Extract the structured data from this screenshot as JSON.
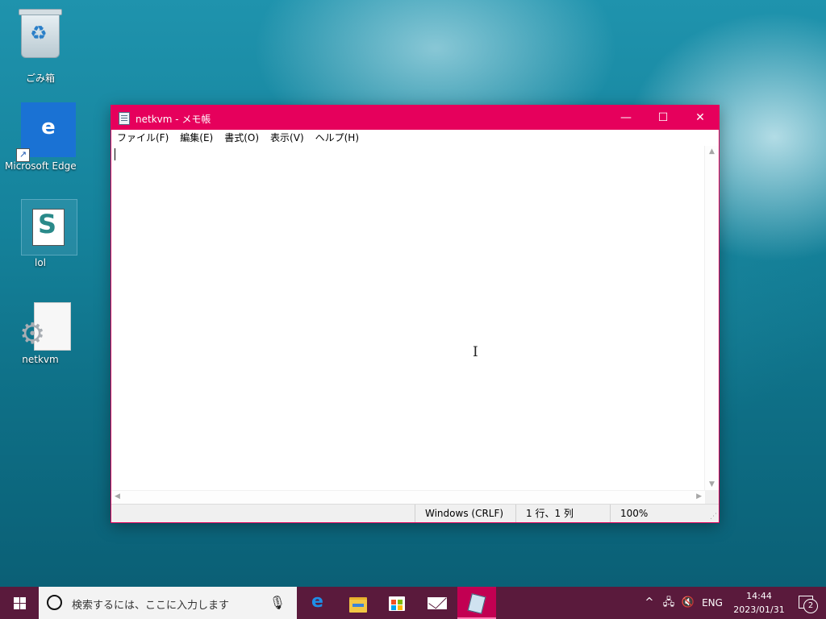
{
  "desktop": {
    "icons": [
      {
        "label": "ごみ箱",
        "icon": "recycle-bin-icon"
      },
      {
        "label": "Microsoft Edge",
        "icon": "edge-icon"
      },
      {
        "label": "lol",
        "icon": "script-file-icon"
      },
      {
        "label": "netkvm",
        "icon": "settings-file-icon"
      }
    ]
  },
  "window": {
    "title": "netkvm - メモ帳",
    "controls": {
      "minimize": "—",
      "maximize": "☐",
      "close": "✕"
    },
    "menu": [
      "ファイル(F)",
      "編集(E)",
      "書式(O)",
      "表示(V)",
      "ヘルプ(H)"
    ],
    "editor": {
      "text": ""
    },
    "scroll": {
      "up": "▲",
      "down": "▼",
      "left": "◀",
      "right": "▶"
    },
    "status": {
      "encoding": "Windows (CRLF)",
      "position": "1 行、1 列",
      "zoom": "100%"
    },
    "accent_color": "#e6005c"
  },
  "taskbar": {
    "search_placeholder": "検索するには、ここに入力します",
    "apps": [
      "edge-icon",
      "file-explorer-icon",
      "store-icon",
      "mail-icon",
      "notepad-icon"
    ],
    "active_app": "notepad-icon",
    "tray": {
      "chevron": "^",
      "language": "ENG",
      "time": "14:44",
      "date": "2023/01/31",
      "notifications": "2"
    },
    "color": "#5a1a3c"
  }
}
